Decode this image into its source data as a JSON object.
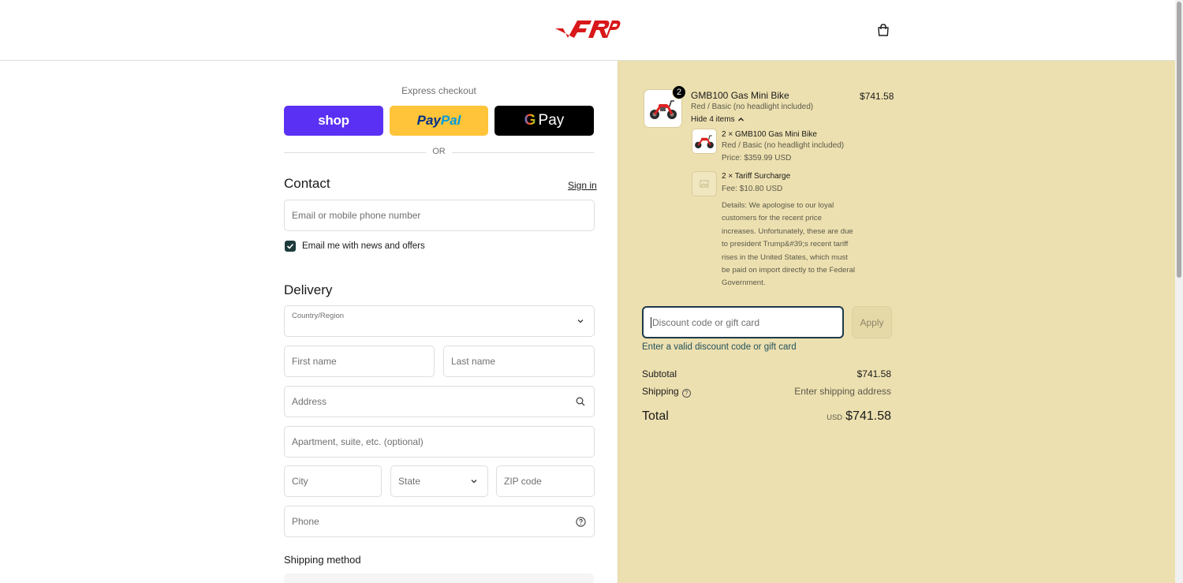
{
  "header": {
    "cart_icon": "shopping-bag-icon",
    "brand_color": "#d8181a"
  },
  "express": {
    "label": "Express checkout",
    "shop_label": "shop",
    "paypal_part1": "Pay",
    "paypal_part2": "Pal",
    "gpay_g": "G",
    "gpay_label": "Pay",
    "or_label": "OR"
  },
  "contact": {
    "title": "Contact",
    "sign_in": "Sign in",
    "email_placeholder": "Email or mobile phone number",
    "newsletter_label": "Email me with news and offers",
    "newsletter_checked": true
  },
  "delivery": {
    "title": "Delivery",
    "country_label": "Country/Region",
    "country_value": "",
    "first_name": "First name",
    "last_name": "Last name",
    "address": "Address",
    "apartment": "Apartment, suite, etc. (optional)",
    "city": "City",
    "state": "State",
    "zip": "ZIP code",
    "phone": "Phone"
  },
  "shipping_method": {
    "title": "Shipping method"
  },
  "summary": {
    "item": {
      "quantity": "2",
      "title": "GMB100 Gas Mini Bike",
      "variant": "Red / Basic (no headlight included)",
      "toggle": "Hide 4 items",
      "price": "$741.58"
    },
    "sub_items": [
      {
        "title": "2 × GMB100 Gas Mini Bike",
        "variant": "Red / Basic (no headlight included)",
        "meta": "Price: $359.99 USD"
      },
      {
        "title": "2 × Tariff Surcharge",
        "meta": "Fee: $10.80 USD",
        "details": "Details: We apologise to our loyal customers for the recent price increases. Unfortunately, these are due to president Trump&#39;s recent tariff rises in the United States, which must be paid on import directly to the Federal Government."
      }
    ],
    "discount": {
      "placeholder": "Discount code or gift card",
      "apply": "Apply",
      "error": "Enter a valid discount code or gift card"
    },
    "subtotal_label": "Subtotal",
    "subtotal_value": "$741.58",
    "shipping_label": "Shipping",
    "shipping_value": "Enter shipping address",
    "total_label": "Total",
    "total_currency": "USD",
    "total_value": "$741.58"
  },
  "colors": {
    "summary_bg": "#ede0b0",
    "shop_pay": "#5a31f4",
    "paypal": "#ffc439",
    "gpay": "#000000",
    "accent": "#1e3a3a"
  }
}
